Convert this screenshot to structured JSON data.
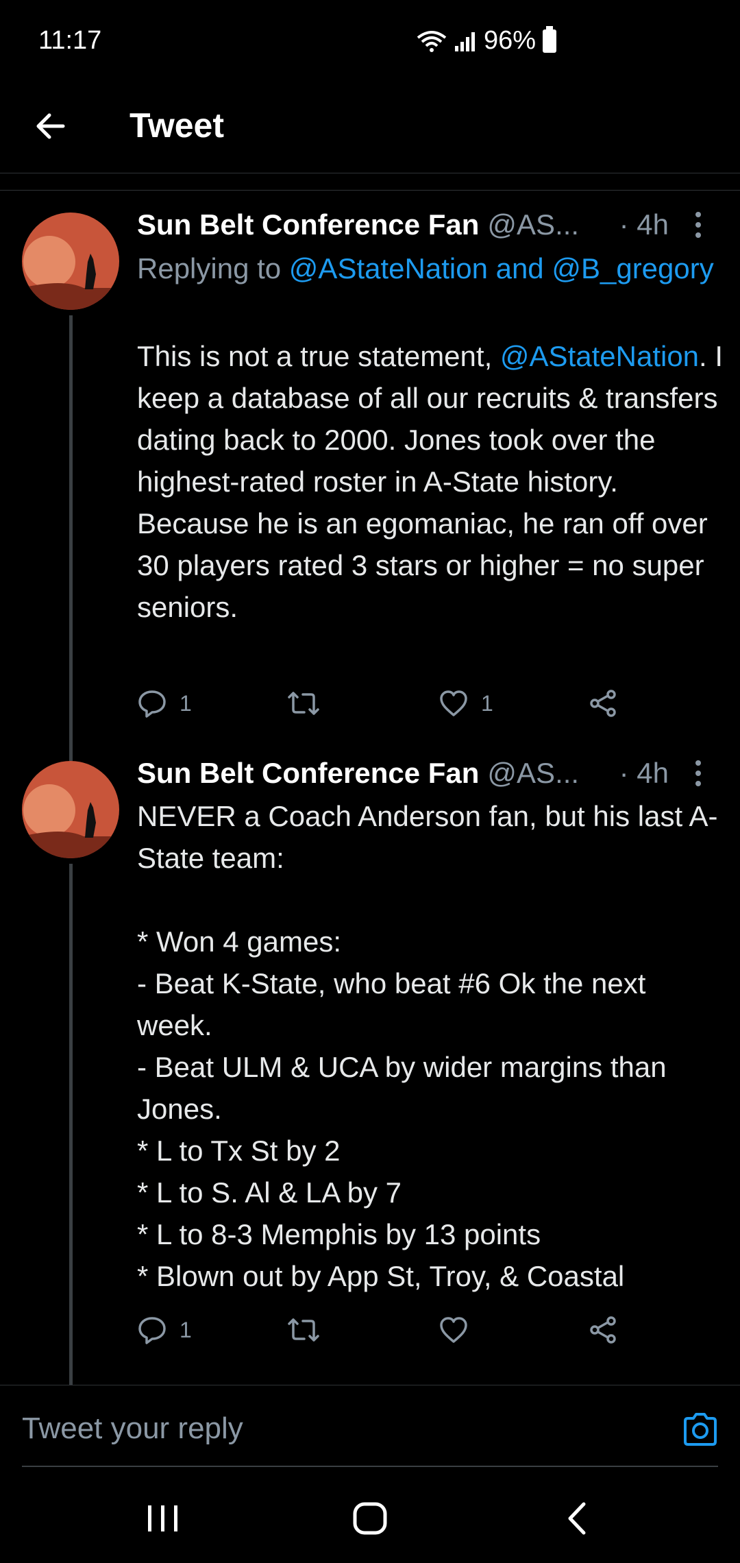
{
  "status_bar": {
    "time": "11:17",
    "battery": "96%"
  },
  "header": {
    "title": "Tweet"
  },
  "tweets": [
    {
      "author": "Sun Belt Conference Fan",
      "handle": "@AS...",
      "time": "· 4h",
      "replying_prefix": "Replying to",
      "replying_to": "@AStateNation and @B_gregory",
      "mention": "@AStateNation",
      "text_before_mention": "This is not a true statement, ",
      "text_after_mention": ". I keep a database of all our recruits & transfers dating back to 2000. Jones took over the highest-rated roster in A-State history. Because he is an egomaniac, he ran off over 30 players rated 3 stars or higher = no super seniors.",
      "reply_count": "1",
      "retweet_count": "",
      "like_count": "1"
    },
    {
      "author": "Sun Belt Conference Fan",
      "handle": "@AS...",
      "time": "· 4h",
      "text": "NEVER a Coach Anderson fan, but his last A-State team:\n\n* Won 4 games:\n- Beat K-State, who beat #6 Ok the next week.\n- Beat ULM & UCA by wider margins than Jones.\n* L to Tx St by 2\n* L to S. Al & LA by 7\n* L to 8-3 Memphis by 13 points\n* Blown out by App St, Troy, & Coastal",
      "reply_count": "1",
      "retweet_count": "",
      "like_count": ""
    }
  ],
  "reply_bar": {
    "placeholder": "Tweet your reply"
  },
  "colors": {
    "accent": "#1d9bf0",
    "muted": "#8b98a5",
    "avatar_bg": "#c8553a"
  },
  "icons": [
    "wifi-icon",
    "signal-icon",
    "battery-icon",
    "back-arrow-icon",
    "more-icon",
    "reply-icon",
    "retweet-icon",
    "like-icon",
    "share-icon",
    "camera-icon",
    "recents-icon",
    "home-icon",
    "nav-back-icon"
  ]
}
